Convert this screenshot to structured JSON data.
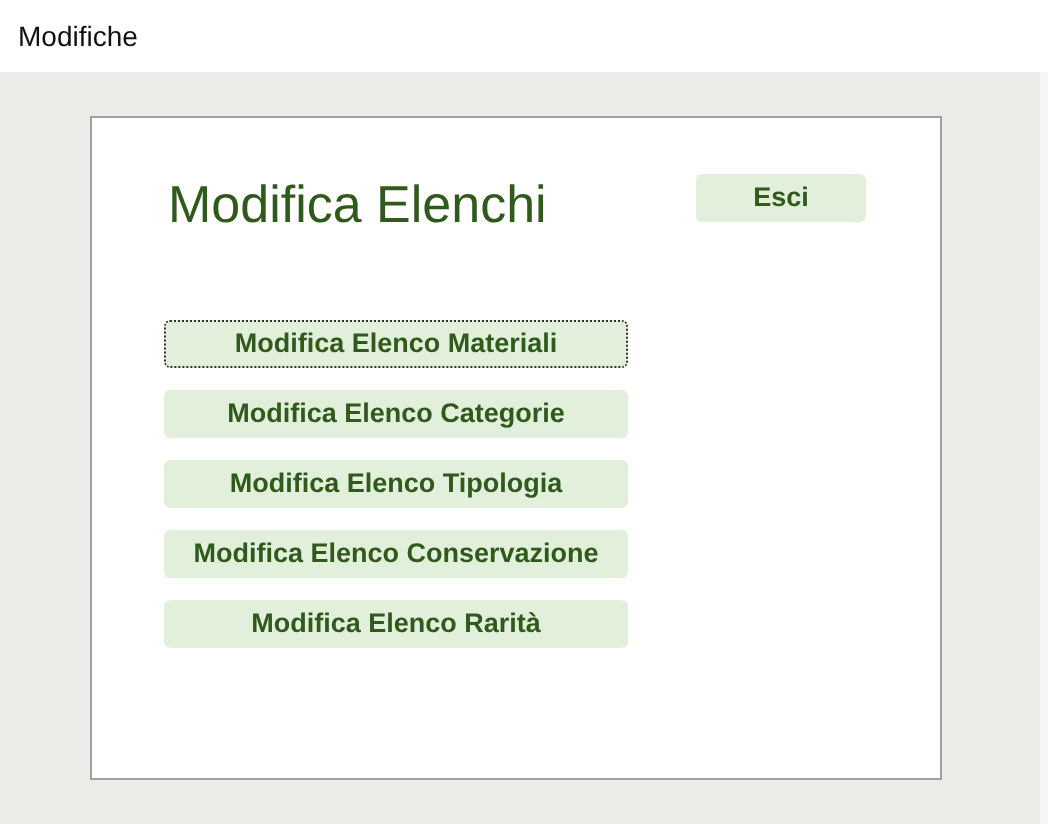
{
  "window": {
    "title": "Modifiche"
  },
  "form": {
    "heading": "Modifica Elenchi",
    "exit_button": "Esci",
    "buttons": [
      {
        "label": "Modifica Elenco Materiali",
        "focused": true
      },
      {
        "label": "Modifica Elenco Categorie",
        "focused": false
      },
      {
        "label": "Modifica Elenco Tipologia",
        "focused": false
      },
      {
        "label": "Modifica Elenco Conservazione",
        "focused": false
      },
      {
        "label": "Modifica Elenco Rarità",
        "focused": false
      }
    ]
  }
}
